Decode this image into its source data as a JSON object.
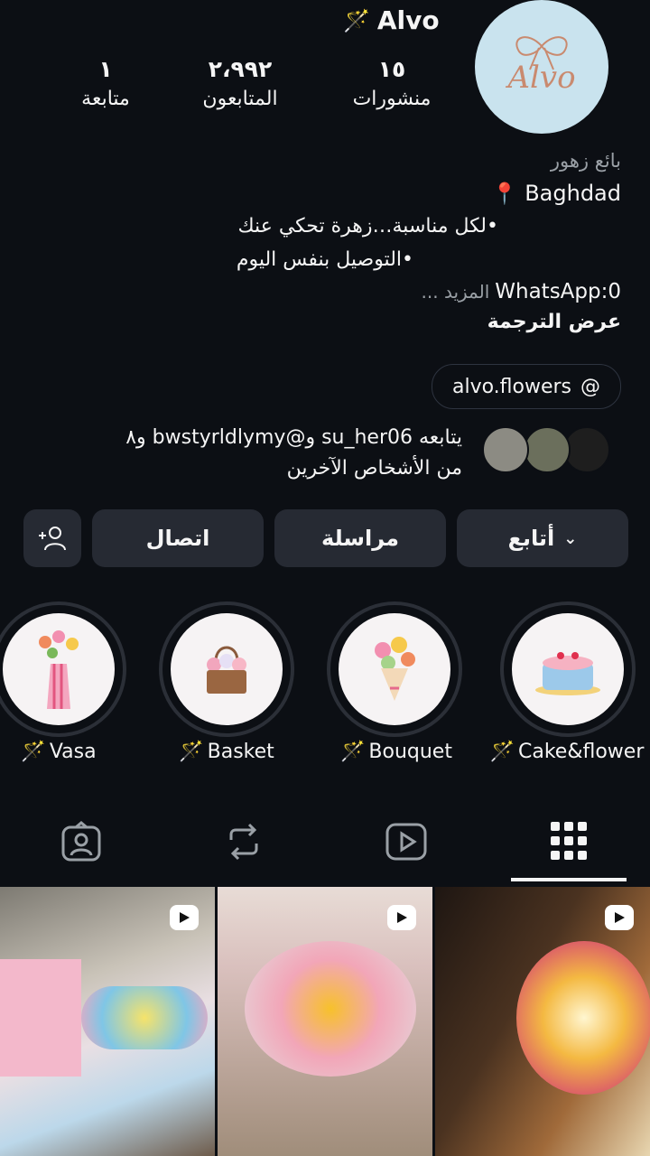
{
  "profile": {
    "username": "Alvo",
    "username_icon": "magic-wand-icon",
    "avatar_text": "Alvo",
    "stats": [
      {
        "num": "١٥",
        "label": "منشورات"
      },
      {
        "num": "٢،٩٩٢",
        "label": "المتابعون"
      },
      {
        "num": "١",
        "label": "متابعة"
      }
    ],
    "category": "بائع زهور",
    "location": "Baghdad",
    "bio_line1": "•لكل مناسبة…زهرة تحكي عنك",
    "bio_line2": "•التوصيل بنفس اليوم",
    "bio_line3": "WhatsApp:0",
    "more": "... المزيد",
    "translate": "عرض الترجمة",
    "threads_handle": "alvo.flowers",
    "followed_by_line1": "يتابعه su_her06 و@bwstyrldlymy و٨",
    "followed_by_line2": "من الأشخاص الآخرين"
  },
  "buttons": {
    "follow": "أتابع",
    "message": "مراسلة",
    "contact": "اتصال"
  },
  "highlights": [
    {
      "label": "Cake&flower"
    },
    {
      "label": "Bouquet"
    },
    {
      "label": "Basket"
    },
    {
      "label": "Vasa"
    }
  ],
  "colors": {
    "background": "#0c0f14",
    "button": "#262a33",
    "avatar_bg": "#c9e3ee"
  }
}
